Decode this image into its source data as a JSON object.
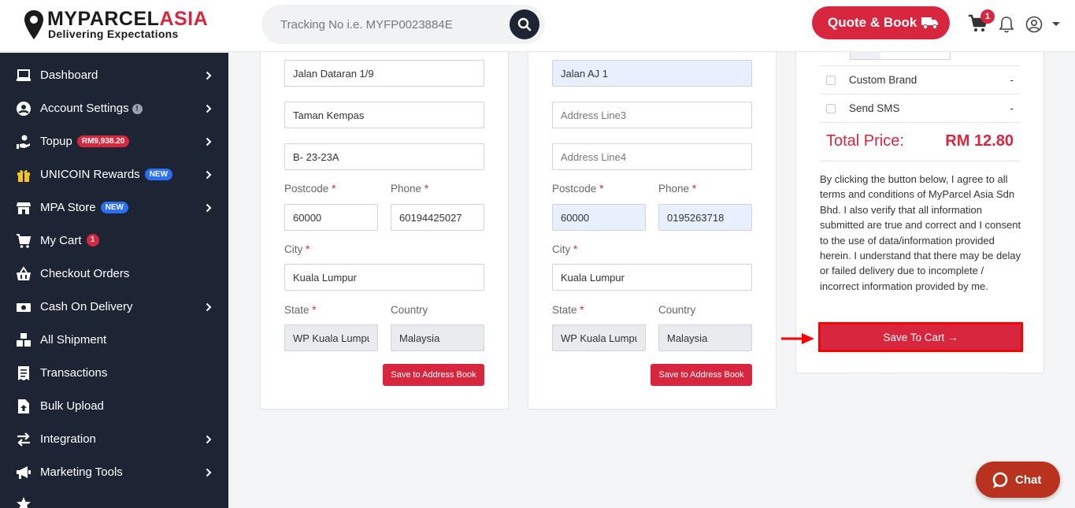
{
  "brand": {
    "name_part1": "MYPARCEL",
    "name_part2": "ASIA",
    "tagline": "Delivering Expectations"
  },
  "search": {
    "placeholder": "Tracking No i.e. MYFP0023884E"
  },
  "header": {
    "quote_label": "Quote & Book",
    "cart_count": "1"
  },
  "sidebar": {
    "items": [
      {
        "label": "Dashboard",
        "icon": "laptop-icon"
      },
      {
        "label": "Account Settings",
        "icon": "user-circle-icon"
      },
      {
        "label": "Topup",
        "badge": "RM9,938.20",
        "icon": "hand-coin-icon"
      },
      {
        "label": "UNICOIN Rewards",
        "badge": "NEW",
        "icon": "gift-icon"
      },
      {
        "label": "MPA Store",
        "badge": "NEW",
        "icon": "store-icon"
      },
      {
        "label": "My Cart",
        "badge": "1",
        "icon": "cart-icon"
      },
      {
        "label": "Checkout Orders",
        "icon": "basket-icon"
      },
      {
        "label": "Cash On Delivery",
        "icon": "cash-icon"
      },
      {
        "label": "All Shipment",
        "icon": "boxes-icon"
      },
      {
        "label": "Transactions",
        "icon": "receipt-icon"
      },
      {
        "label": "Bulk Upload",
        "icon": "file-upload-icon"
      },
      {
        "label": "Integration",
        "icon": "arrows-icon"
      },
      {
        "label": "Marketing Tools",
        "icon": "megaphone-icon"
      }
    ]
  },
  "sender": {
    "address1": "Jalan Dataran 1/9",
    "address2": "Taman Kempas",
    "address3": "B- 23-23A",
    "postcode_label": "Postcode",
    "postcode": "60000",
    "phone_label": "Phone",
    "phone": "60194425027",
    "city_label": "City",
    "city": "Kuala Lumpur",
    "state_label": "State",
    "state": "WP Kuala Lumpur",
    "country_label": "Country",
    "country": "Malaysia",
    "save_label": "Save to Address Book"
  },
  "receiver": {
    "address1": "Jalan AJ 1",
    "address3_placeholder": "Address Line3",
    "address4_placeholder": "Address Line4",
    "postcode_label": "Postcode",
    "postcode": "60000",
    "phone_label": "Phone",
    "phone": "0195263718",
    "city_label": "City",
    "city": "Kuala Lumpur",
    "state_label": "State",
    "state": "WP Kuala Lumpur",
    "country_label": "Country",
    "country": "Malaysia",
    "save_label": "Save to Address Book"
  },
  "summary": {
    "options": [
      {
        "name": "Custom Brand",
        "value": "-"
      },
      {
        "name": "Send SMS",
        "value": "-"
      }
    ],
    "total_label": "Total Price:",
    "total_value": "RM 12.80",
    "terms": "By clicking the button below, I agree to all terms and conditions of MyParcel Asia Sdn Bhd. I also verify that all information submitted are true and correct and I consent to the use of data/information provided herein. I understand that there may be delay or failed delivery due to incomplete / incorrect information provided by me.",
    "cart_button": "Save To Cart →"
  },
  "chat": {
    "label": "Chat"
  },
  "colors": {
    "accent": "#d7263d",
    "sidebar": "#1d2433",
    "chat": "#b9321e"
  }
}
